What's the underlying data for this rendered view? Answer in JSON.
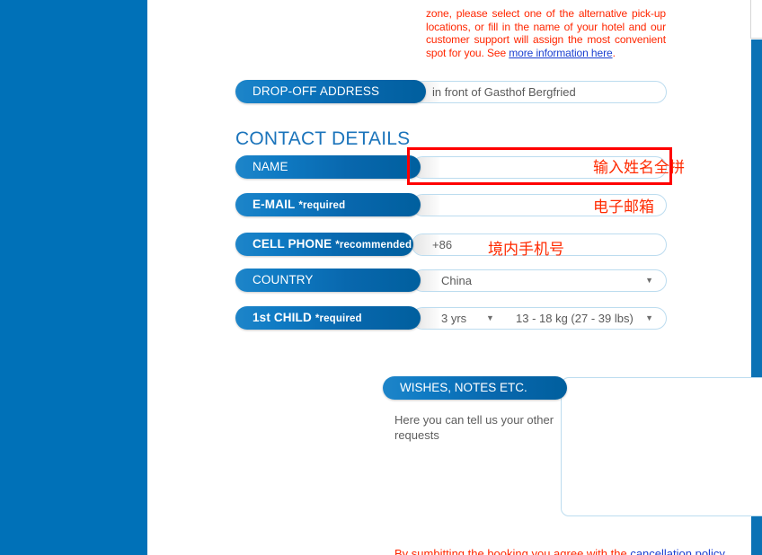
{
  "page": {
    "notice_text_before_link": "zone, please select one of the alternative pick-up locations, or fill in the name of your hotel and our customer support will assign the most convenient spot for you. See ",
    "notice_link": "more information here",
    "notice_text_after_link": ".",
    "clipped_top_line": "",
    "footer_before_link": "By sumbitting the booking you agree with the ",
    "footer_link": "cancellation policy",
    "footer_after_link": ""
  },
  "dropoff": {
    "label": "DROP-OFF ADDRESS",
    "value": "in front of Gasthof Bergfried"
  },
  "contact": {
    "heading": "CONTACT DETAILS",
    "rows": [
      {
        "name": "name",
        "label": "NAME",
        "required_tag": "",
        "value": "",
        "annotation": "输入姓名全拼"
      },
      {
        "name": "email",
        "label": "E-MAIL",
        "required_tag": "*required",
        "value": "",
        "annotation": "电子邮箱"
      },
      {
        "name": "cell-phone",
        "label": "CELL PHONE",
        "required_tag": "*recommended",
        "value": "+86",
        "annotation": "境内手机号"
      }
    ],
    "country": {
      "label": "COUNTRY",
      "value": "China",
      "caret": "▼"
    },
    "child": {
      "label": "1st CHILD",
      "required_tag": "*required",
      "age_value": "3 yrs",
      "age_caret": "▼",
      "weight_value": "13 - 18 kg (27 - 39 lbs)",
      "weight_caret": "▼"
    }
  },
  "wishes": {
    "label": "WISHES, NOTES ETC.",
    "help": "Here you can tell us your other requests",
    "textarea_value": ""
  },
  "colors": {
    "rail_blue": "#0071b8",
    "pill_blue": "#0f7bc4",
    "heading_blue": "#1b74bb",
    "annotation_red": "#ff2a00",
    "highlight_red": "#ff0000",
    "link_blue": "#1a3fd0"
  }
}
